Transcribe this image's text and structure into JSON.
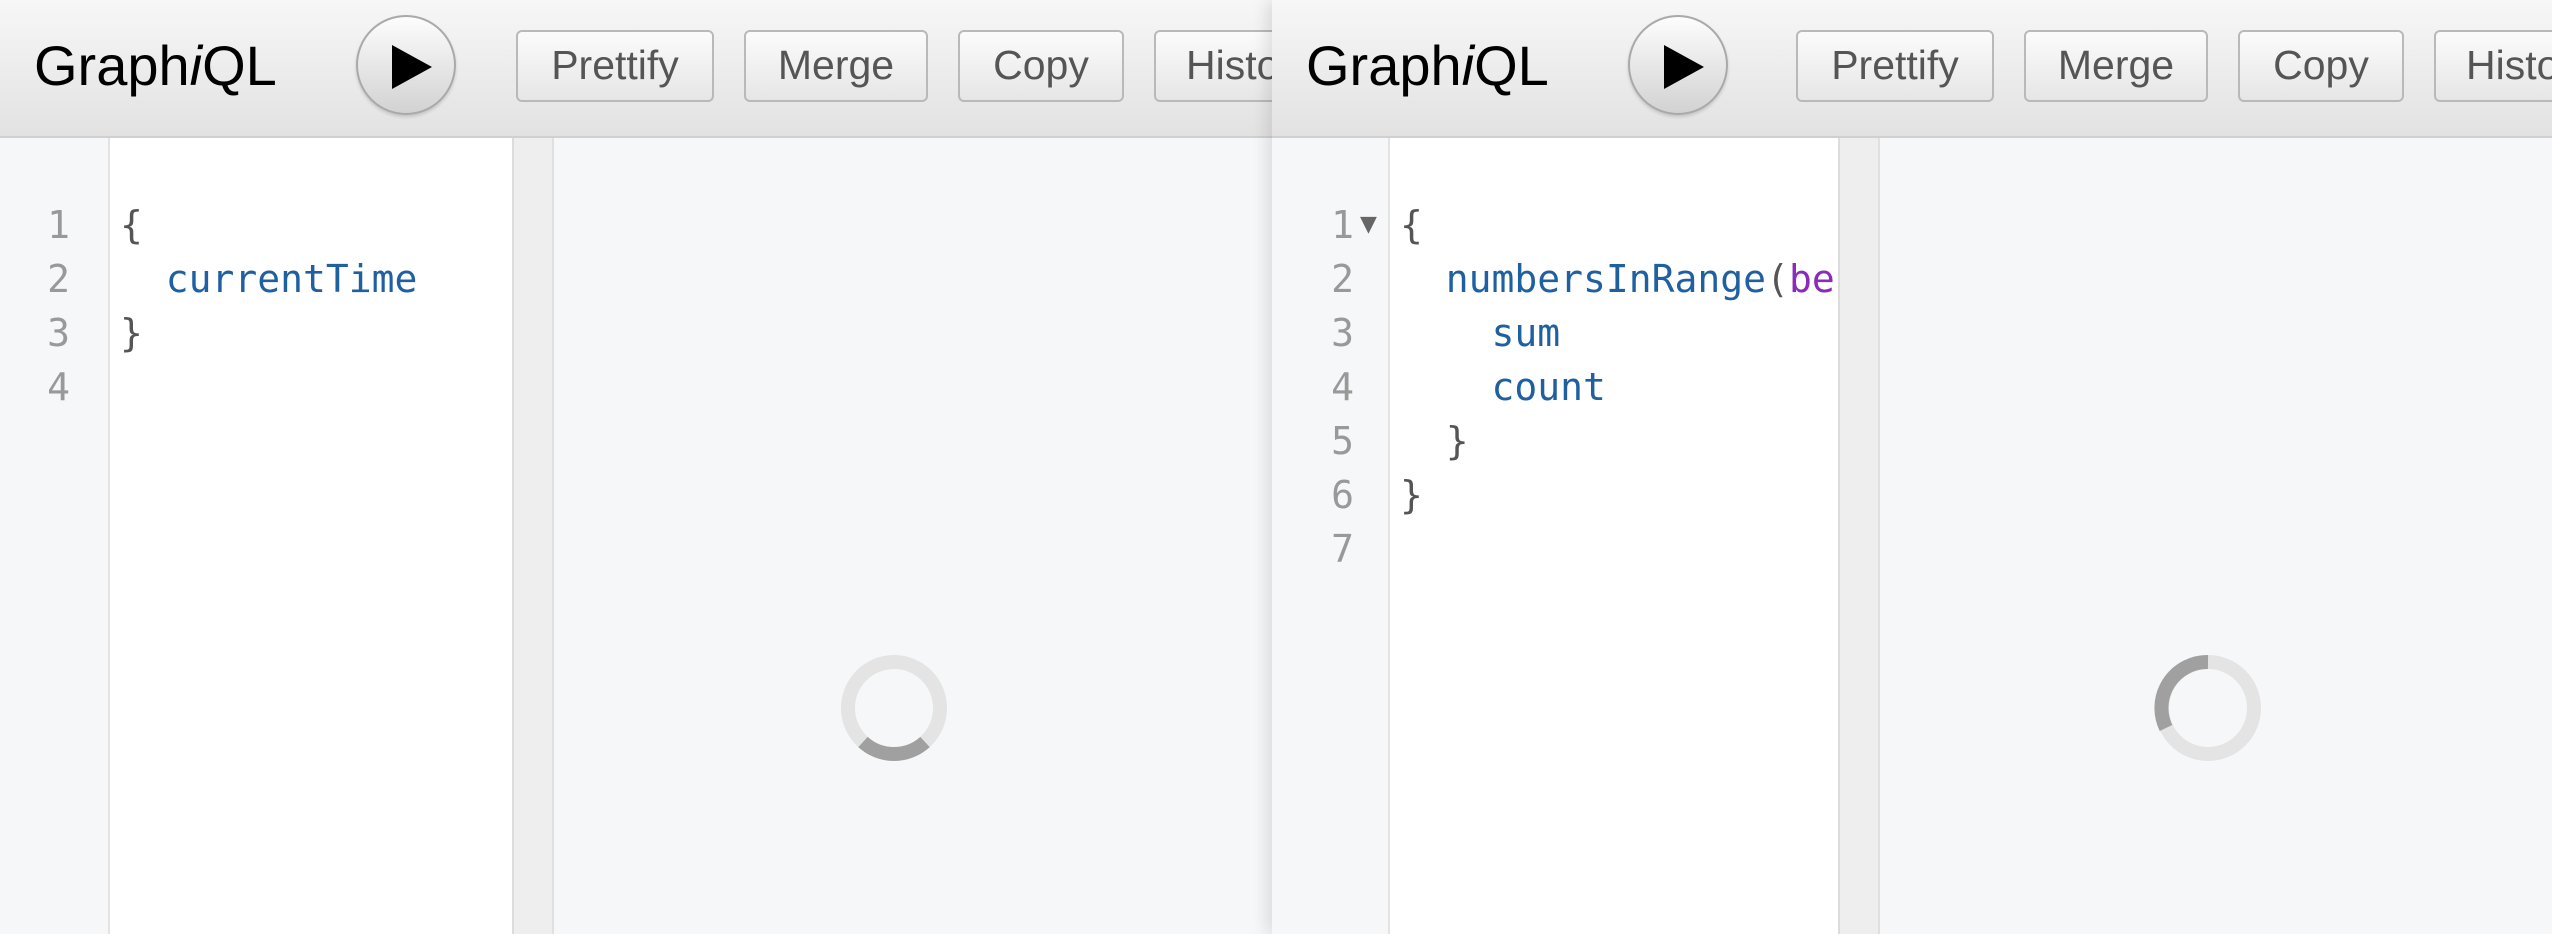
{
  "panes": [
    {
      "logo": {
        "prefix": "Graph",
        "italic": "i",
        "suffix": "QL"
      },
      "toolbar": {
        "prettify": "Prettify",
        "merge": "Merge",
        "copy": "Copy",
        "history": "History"
      },
      "editor": {
        "line_numbers": [
          "1",
          "2",
          "3",
          "4"
        ],
        "lines": [
          [
            {
              "t": "punc",
              "v": "{"
            }
          ],
          [
            {
              "t": "punc",
              "v": "  "
            },
            {
              "t": "field",
              "v": "currentTime"
            }
          ],
          [
            {
              "t": "punc",
              "v": "}"
            }
          ],
          []
        ]
      },
      "result": {
        "state": "loading"
      }
    },
    {
      "logo": {
        "prefix": "Graph",
        "italic": "i",
        "suffix": "QL"
      },
      "toolbar": {
        "prettify": "Prettify",
        "merge": "Merge",
        "copy": "Copy",
        "history": "History"
      },
      "editor": {
        "line_numbers": [
          "1",
          "2",
          "3",
          "4",
          "5",
          "6",
          "7"
        ],
        "lines": [
          [
            {
              "t": "punc",
              "v": "{"
            }
          ],
          [
            {
              "t": "punc",
              "v": "  "
            },
            {
              "t": "field",
              "v": "numbersInRange"
            },
            {
              "t": "punc",
              "v": "("
            },
            {
              "t": "arg",
              "v": "beg"
            }
          ],
          [
            {
              "t": "punc",
              "v": "    "
            },
            {
              "t": "field",
              "v": "sum"
            }
          ],
          [
            {
              "t": "punc",
              "v": "    "
            },
            {
              "t": "field",
              "v": "count"
            }
          ],
          [
            {
              "t": "punc",
              "v": "  }"
            }
          ],
          [
            {
              "t": "punc",
              "v": "}"
            }
          ],
          []
        ]
      },
      "result": {
        "state": "loading"
      }
    }
  ],
  "colors": {
    "field": "#1f61a0",
    "argument": "#8b2bb9",
    "punctuation": "#555555",
    "line_number": "#999999"
  },
  "icons": {
    "execute": "play-icon",
    "fold": "fold-arrow-icon",
    "loading": "spinner-icon"
  }
}
